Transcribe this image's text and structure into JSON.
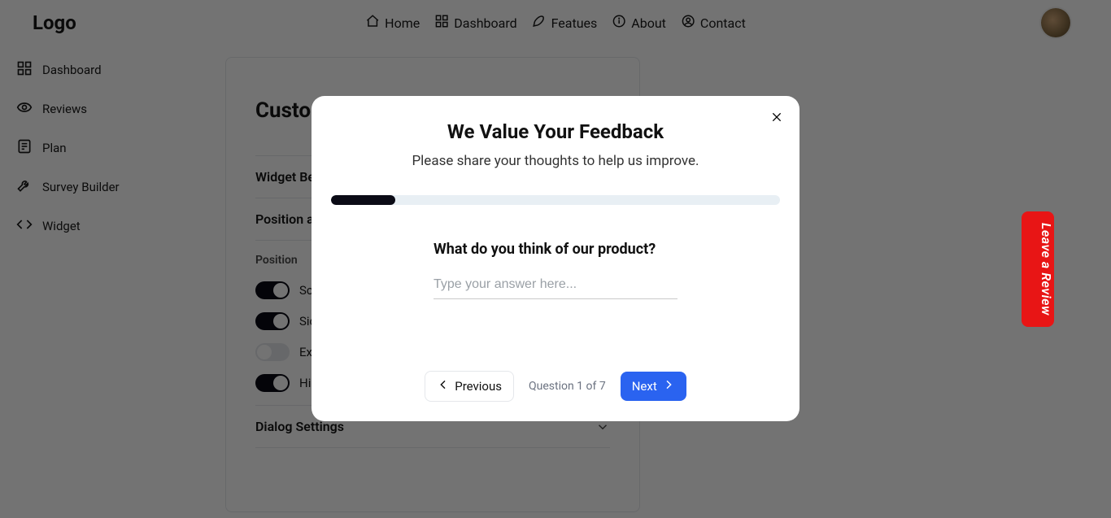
{
  "brand": "Logo",
  "top_nav": {
    "items": [
      {
        "label": "Home"
      },
      {
        "label": "Dashboard"
      },
      {
        "label": "Featues"
      },
      {
        "label": "About"
      },
      {
        "label": "Contact"
      }
    ]
  },
  "sidebar": {
    "items": [
      {
        "label": "Dashboard"
      },
      {
        "label": "Reviews"
      },
      {
        "label": "Plan"
      },
      {
        "label": "Survey Builder"
      },
      {
        "label": "Widget"
      }
    ]
  },
  "main": {
    "title": "Customize Your Widget",
    "sections": {
      "behavior_label": "Widget Behavior",
      "position_label": "Position and Layout",
      "dialog_settings_label": "Dialog Settings"
    },
    "position_subhead": "Position",
    "toggles": [
      {
        "label": "Scroll to top",
        "on": true
      },
      {
        "label": "Side placement",
        "on": true
      },
      {
        "label": "Expand on load",
        "on": false
      },
      {
        "label": "Hide on mobile",
        "on": true
      }
    ]
  },
  "side_tab": {
    "label": "Leave a Review"
  },
  "dialog": {
    "title": "We Value Your Feedback",
    "subtitle": "Please share your thoughts to help us improve.",
    "question": "What do you think of our product?",
    "placeholder": "Type your answer here...",
    "prev_label": "Previous",
    "next_label": "Next",
    "pager_text": "Question 1 of 7",
    "progress_pct": 14.3,
    "current": 1,
    "total": 7
  }
}
